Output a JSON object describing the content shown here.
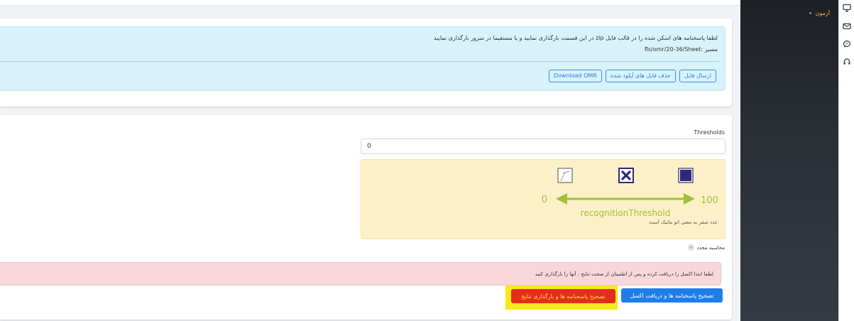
{
  "upload_card": {
    "instruction_line1": "لطفا پاسخنامه های اسکن شده را در قالب فایل zip در این قسمت بارگذاری نمایید و یا مستقیما در سرور بارگذاری نمایید",
    "instruction_line2": "مسیر :fls/omr/20-36/Sheet",
    "buttons": {
      "send_file": "ارسال فایل",
      "delete_uploaded": "حذف فایل های آپلود شده",
      "download_omr": "Download OMR"
    }
  },
  "threshold_card": {
    "label": "Thresholds",
    "value": "0",
    "diagram": {
      "min": "0",
      "max": "100",
      "caption": "recognitionThreshold",
      "arrow_color": "#9dc13b",
      "icon_color": "#2b2a7a"
    },
    "note": "عدد صفر به معنی اتو ماتیک است",
    "recalc_label": "محاسبه مجدد"
  },
  "alert": {
    "text": "لطفا ابتدا اکسل را دریافت کرده و پس از اطمینان از صحت نتایج ، آنها را بارگذاری کنید"
  },
  "actions": {
    "correct_and_excel": "تصحیح پاسخنامه ها و دریافت اکسل",
    "correct_and_upload": "تصحیح پاسخنامه ها و بارگذاری نتایج"
  },
  "sidebar": {
    "item_label": "آزمون"
  },
  "rail_icons": [
    "monitor-icon",
    "mail-icon",
    "chat-icon",
    "headset-icon"
  ]
}
